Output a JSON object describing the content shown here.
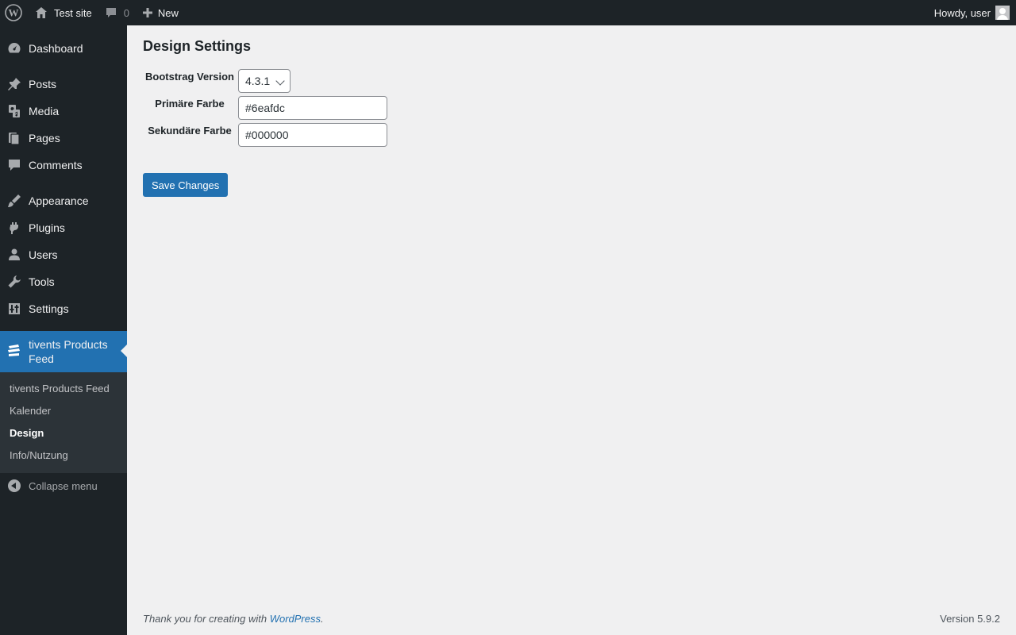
{
  "admin_bar": {
    "site_name": "Test site",
    "comments_count": "0",
    "new_label": "New",
    "greeting": "Howdy, user"
  },
  "sidebar": {
    "items": [
      {
        "label": "Dashboard",
        "icon": "dashboard-icon"
      },
      {
        "label": "Posts",
        "icon": "pin-icon"
      },
      {
        "label": "Media",
        "icon": "media-icon"
      },
      {
        "label": "Pages",
        "icon": "pages-icon"
      },
      {
        "label": "Comments",
        "icon": "comment-icon"
      },
      {
        "label": "Appearance",
        "icon": "brush-icon"
      },
      {
        "label": "Plugins",
        "icon": "plugin-icon"
      },
      {
        "label": "Users",
        "icon": "users-icon"
      },
      {
        "label": "Tools",
        "icon": "wrench-icon"
      },
      {
        "label": "Settings",
        "icon": "settings-icon"
      },
      {
        "label": "tivents Products Feed",
        "icon": "tickets-icon",
        "current": true
      }
    ],
    "submenu": [
      {
        "label": "tivents Products Feed"
      },
      {
        "label": "Kalender"
      },
      {
        "label": "Design",
        "active": true
      },
      {
        "label": "Info/Nutzung"
      }
    ],
    "collapse_label": "Collapse menu"
  },
  "main": {
    "title": "Design Settings",
    "fields": {
      "bootstrap_label": "Bootstrag Version",
      "bootstrap_value": "4.3.1",
      "primary_label": "Primäre Farbe",
      "primary_value": "#6eafdc",
      "secondary_label": "Sekundäre Farbe",
      "secondary_value": "#000000"
    },
    "save_label": "Save Changes"
  },
  "footer": {
    "thanks_text": "Thank you for creating with ",
    "link_text": "WordPress",
    "period": ".",
    "version": "Version 5.9.2"
  },
  "colors": {
    "admin_bar_bg": "#1d2327",
    "accent": "#2271b1",
    "submenu_bg": "#2c3338",
    "content_bg": "#f0f0f1"
  }
}
